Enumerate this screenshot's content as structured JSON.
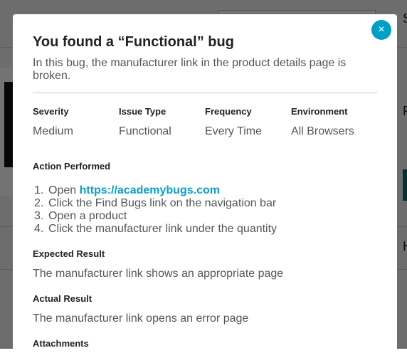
{
  "modal": {
    "title": "You found a “Functional” bug",
    "description": "In this bug, the manufacturer link in the product details page is broken.",
    "close_symbol": "×",
    "meta": [
      {
        "label": "Severity",
        "value": "Medium"
      },
      {
        "label": "Issue Type",
        "value": "Functional"
      },
      {
        "label": "Frequency",
        "value": "Every Time"
      },
      {
        "label": "Environment",
        "value": "All Browsers"
      }
    ],
    "action_performed": {
      "heading": "Action Performed",
      "steps": [
        {
          "num": "1.",
          "text": "Open ",
          "link": "https://academybugs.com"
        },
        {
          "num": "2.",
          "text": "Click the Find Bugs link on the navigation bar"
        },
        {
          "num": "3.",
          "text": "Open a product"
        },
        {
          "num": "4.",
          "text": "Click the manufacturer link under the quantity"
        }
      ]
    },
    "expected_result": {
      "heading": "Expected Result",
      "text": "The manufacturer link shows an appropriate page"
    },
    "actual_result": {
      "heading": "Actual Result",
      "text": "The manufacturer link opens an error page"
    },
    "attachments": {
      "heading": "Attachments"
    }
  },
  "background": {
    "right_letters": [
      "S",
      "F",
      "H"
    ]
  },
  "colors": {
    "accent": "#00a0c6",
    "link": "#0aa0c8",
    "overlay": "rgba(0,0,0,0.55)"
  },
  "icons": {
    "close": "close-icon"
  }
}
